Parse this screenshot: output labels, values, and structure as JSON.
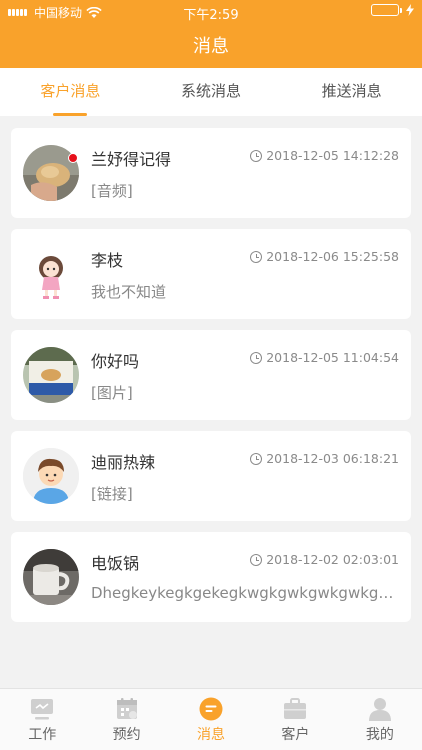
{
  "status_bar": {
    "carrier": "中国移动",
    "time": "下午2:59"
  },
  "header": {
    "title": "消息"
  },
  "tabs": [
    {
      "label": "客户消息",
      "active": true
    },
    {
      "label": "系统消息",
      "active": false
    },
    {
      "label": "推送消息",
      "active": false
    }
  ],
  "messages": [
    {
      "name": "兰妤得记得",
      "time": "2018-12-05 14:12:28",
      "preview": "[音频]",
      "unread": true,
      "avatar": "potato-photo-avatar"
    },
    {
      "name": "李枝",
      "time": "2018-12-06 15:25:58",
      "preview": "我也不知道",
      "unread": false,
      "avatar": "cartoon-girl-avatar"
    },
    {
      "name": "你好吗",
      "time": "2018-12-05 11:04:54",
      "preview": "[图片]",
      "unread": false,
      "avatar": "snack-box-photo-avatar"
    },
    {
      "name": "迪丽热辣",
      "time": "2018-12-03 06:18:21",
      "preview": "[链接]",
      "unread": false,
      "avatar": "cartoon-boy-avatar"
    },
    {
      "name": "电饭锅",
      "time": "2018-12-02 02:03:01",
      "preview": "Dhegkeykegkgekegkwgkgwkgwkgwkgwkgwkgwkg",
      "unread": false,
      "avatar": "mug-photo-avatar"
    }
  ],
  "bottom_nav": [
    {
      "label": "工作",
      "icon": "monitor-icon",
      "active": false
    },
    {
      "label": "预约",
      "icon": "calendar-icon",
      "active": false
    },
    {
      "label": "消息",
      "icon": "message-icon",
      "active": true
    },
    {
      "label": "客户",
      "icon": "briefcase-icon",
      "active": false
    },
    {
      "label": "我的",
      "icon": "person-icon",
      "active": false
    }
  ],
  "colors": {
    "accent": "#f9a22b",
    "unread_dot": "#e6101b",
    "battery": "#8ee65e"
  }
}
